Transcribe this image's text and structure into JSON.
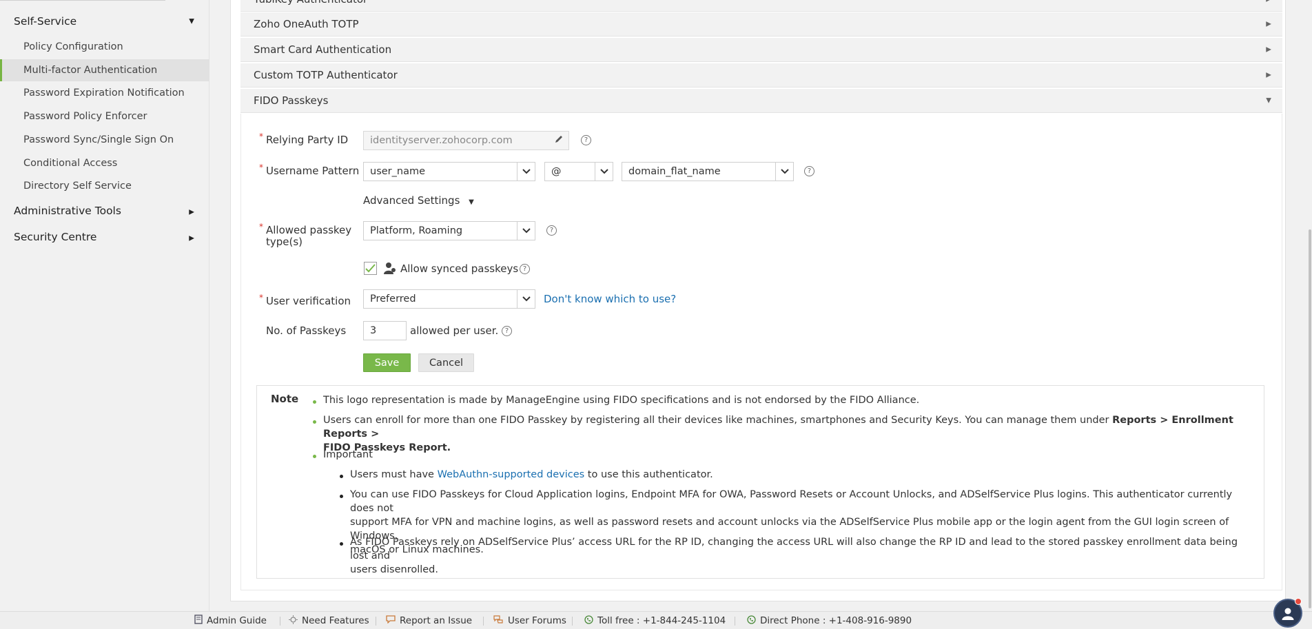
{
  "sidebar": {
    "sections": [
      {
        "label": "Self-Service",
        "expanded": true
      },
      {
        "label": "Administrative Tools",
        "expanded": false
      },
      {
        "label": "Security Centre",
        "expanded": false
      }
    ],
    "items": [
      {
        "label": "Policy Configuration",
        "active": false
      },
      {
        "label": "Multi-factor Authentication",
        "active": true
      },
      {
        "label": "Password Expiration Notification",
        "active": false
      },
      {
        "label": "Password Policy Enforcer",
        "active": false
      },
      {
        "label": "Password Sync/Single Sign On",
        "active": false
      },
      {
        "label": "Conditional Access",
        "active": false
      },
      {
        "label": "Directory Self Service",
        "active": false
      }
    ]
  },
  "accordion": {
    "rows": [
      {
        "label": "YubiKey Authenticator"
      },
      {
        "label": "Zoho OneAuth TOTP"
      },
      {
        "label": "Smart Card Authentication"
      },
      {
        "label": "Custom TOTP Authenticator"
      },
      {
        "label": "FIDO Passkeys"
      }
    ]
  },
  "form": {
    "relying_party_label": "Relying Party ID",
    "relying_party_value": "identityserver.zohocorp.com",
    "username_pattern_label": "Username Pattern",
    "username_part1": "user_name",
    "username_sep": "@",
    "username_part2": "domain_flat_name",
    "advanced_settings": "Advanced Settings",
    "passkey_type_label_1": "Allowed passkey",
    "passkey_type_label_2": "type(s)",
    "passkey_type_value": "Platform, Roaming",
    "synced_label": "Allow synced passkeys",
    "synced_checked": true,
    "user_verification_label": "User verification",
    "user_verification_value": "Preferred",
    "dont_know_link": "Don't know which to use?",
    "num_passkeys_label": "No. of Passkeys",
    "num_passkeys_value": "3",
    "allowed_per_user": "allowed per user.",
    "help_glyph": "?",
    "save": "Save",
    "cancel": "Cancel"
  },
  "note": {
    "title": "Note",
    "b1": "This logo representation is made by ManageEngine using FIDO specifications and is not endorsed by the FIDO Alliance.",
    "b2_text": "Users can enroll for more than one FIDO Passkey by registering all their devices like machines, smartphones and Security Keys. You can manage them under",
    "b2_bold_1": "Reports > Enrollment Reports >",
    "b2_bold_2": "FIDO Passkeys Report.",
    "b3": "Important",
    "s1_pre": "Users must have",
    "s1_link": "WebAuthn-supported devices",
    "s1_post": "to use this authenticator.",
    "s2_l1": "You can use FIDO Passkeys for Cloud Application logins, Endpoint MFA for OWA, Password Resets or Account Unlocks, and ADSelfService Plus logins. This authenticator currently does not",
    "s2_l2": "support MFA for VPN and machine logins, as well as password resets and account unlocks via the ADSelfService Plus mobile app or the login agent from the GUI login screen of Windows,",
    "s2_l3": "macOS or Linux machines.",
    "s3_l1": "As FIDO Passkeys rely on ADSelfService Plus’ access URL for the RP ID, changing the access URL will also change the RP ID and lead to the stored passkey enrollment data being lost and",
    "s3_l2": "users disenrolled."
  },
  "footer": {
    "admin_guide": "Admin Guide",
    "need_features": "Need Features",
    "report_issue": "Report an Issue",
    "user_forums": "User Forums",
    "toll_free": "Toll free : +1-844-245-1104",
    "direct_phone": "Direct Phone : +1-408-916-9890"
  },
  "colors": {
    "accent_green": "#79b84a",
    "link_blue": "#1a6fb0",
    "required_red": "#d9342b"
  }
}
